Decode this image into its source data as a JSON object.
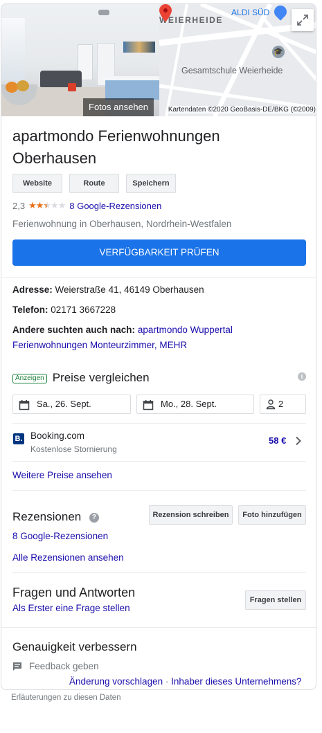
{
  "media": {
    "photos_label": "Fotos ansehen",
    "map": {
      "street_label": "WEIERHEIDE",
      "poi_aldi": "ALDI SÜD",
      "poi_school": "Gesamtschule Weierheide",
      "attribution": "Kartendaten ©2020 GeoBasis-DE/BKG (©2009)"
    }
  },
  "business": {
    "name": "apartmondo Ferienwohnungen Oberhausen",
    "buttons": {
      "website": "Website",
      "route": "Route",
      "save": "Speichern"
    },
    "rating": {
      "value": "2,3",
      "stars": 2.3,
      "reviews_link": "8 Google-Rezensionen"
    },
    "category": "Ferienwohnung in Oberhausen, Nordrhein-Westfalen",
    "check_availability": "VERFÜGBARKEIT PRÜFEN"
  },
  "details": {
    "address_label": "Adresse:",
    "address": "Weierstraße 41, 46149 Oberhausen",
    "phone_label": "Telefon:",
    "phone": "02171 3667228",
    "also_searched_label": "Andere suchten auch nach:",
    "also_searched": [
      "apartmondo Wuppertal",
      "Ferienwohnungen Monteurzimmer",
      "MEHR"
    ]
  },
  "prices": {
    "ad_badge": "Anzeigen",
    "title": "Preise vergleichen",
    "checkin": "Sa., 26. Sept.",
    "checkout": "Mo., 28. Sept.",
    "guests": "2",
    "offer": {
      "provider": "Booking.com",
      "logo_letter": "B.",
      "note": "Kostenlose Stornierung",
      "price": "58 €"
    },
    "more_prices": "Weitere Preise ansehen"
  },
  "reviews": {
    "title": "Rezensionen",
    "write_button": "Rezension schreiben",
    "add_photo_button": "Foto hinzufügen",
    "google_reviews_link": "8 Google-Rezensionen",
    "all_reviews_link": "Alle Rezensionen ansehen"
  },
  "qa": {
    "title": "Fragen und Antworten",
    "first_question_link": "Als Erster eine Frage stellen",
    "ask_button": "Fragen stellen"
  },
  "accuracy": {
    "title": "Genauigkeit verbessern",
    "feedback": "Feedback geben",
    "suggest_edit": "Änderung vorschlagen",
    "separator": "·",
    "owner_link": "Inhaber dieses Unternehmens?"
  },
  "footer": {
    "explanation": "Erläuterungen zu diesen Daten"
  },
  "colors": {
    "primary": "#1a73e8",
    "link": "#1a0dab",
    "star": "#e7711b",
    "ad_green": "#188038",
    "booking_blue": "#003580"
  }
}
